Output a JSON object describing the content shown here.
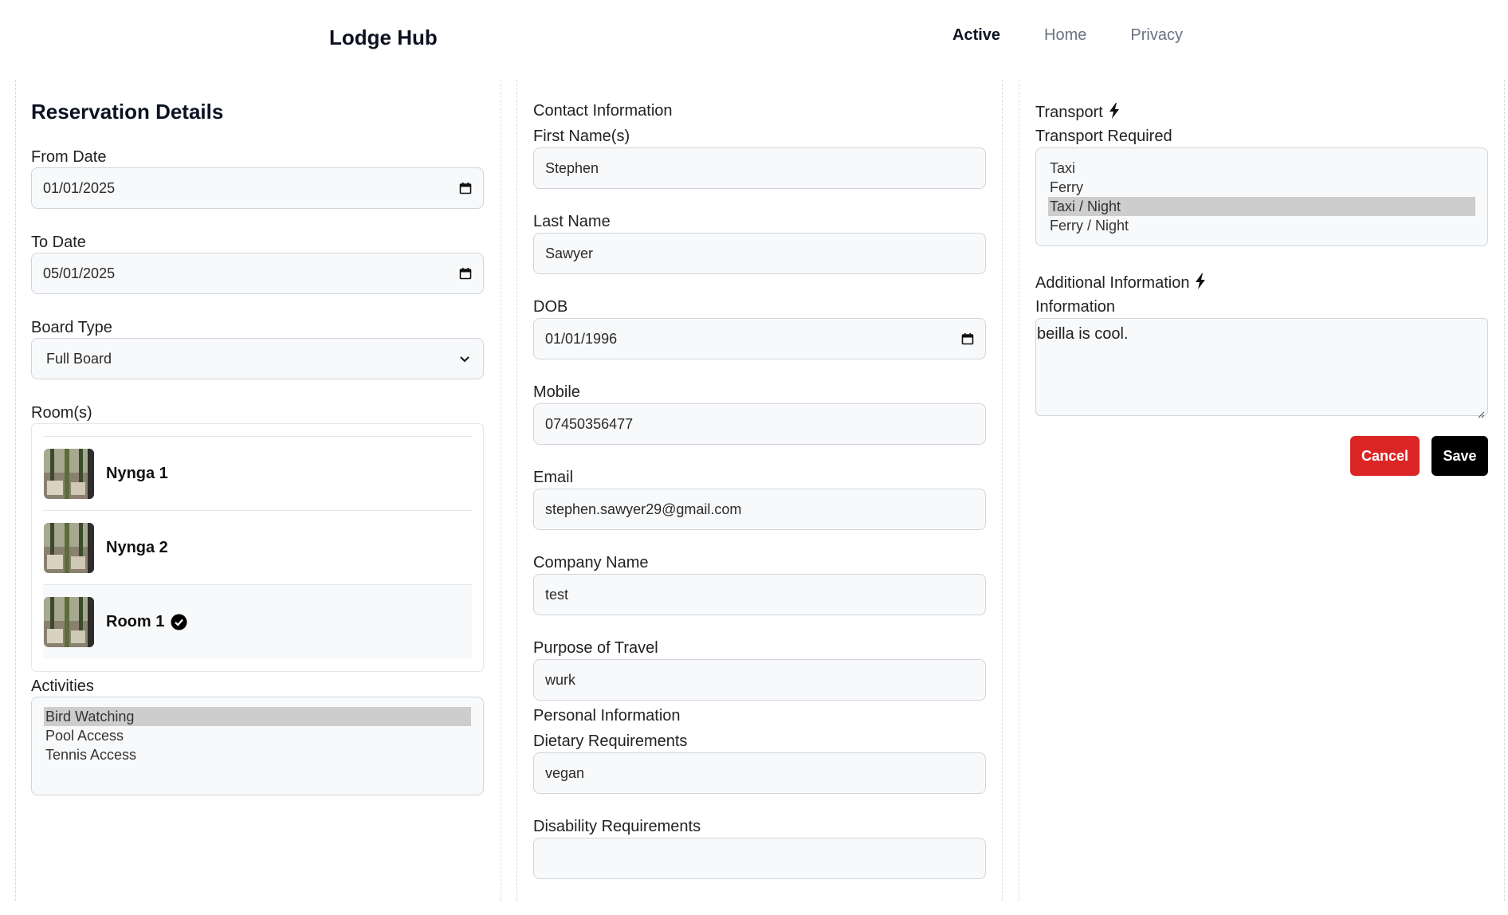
{
  "header": {
    "brand": "Lodge Hub",
    "nav": [
      {
        "label": "Active",
        "active": true
      },
      {
        "label": "Home",
        "active": false
      },
      {
        "label": "Privacy",
        "active": false
      }
    ]
  },
  "reservation": {
    "title": "Reservation Details",
    "from_date": {
      "label": "From Date",
      "value": "01/01/2025"
    },
    "to_date": {
      "label": "To Date",
      "value": "05/01/2025"
    },
    "board_type": {
      "label": "Board Type",
      "value": "Full Board"
    },
    "rooms": {
      "label": "Room(s)",
      "items": [
        {
          "name": "Nynga 1",
          "selected": false
        },
        {
          "name": "Nynga 2",
          "selected": false
        },
        {
          "name": "Room 1",
          "selected": true
        }
      ]
    },
    "activities": {
      "label": "Activities",
      "options": [
        "Bird Watching",
        "Pool Access",
        "Tennis Access"
      ],
      "selected": "Bird Watching"
    }
  },
  "contact": {
    "section_label": "Contact Information",
    "first_name": {
      "label": "First Name(s)",
      "value": "Stephen"
    },
    "last_name": {
      "label": "Last Name",
      "value": "Sawyer"
    },
    "dob": {
      "label": "DOB",
      "value": "01/01/1996"
    },
    "mobile": {
      "label": "Mobile",
      "value": "07450356477"
    },
    "email": {
      "label": "Email",
      "value": "stephen.sawyer29@gmail.com"
    },
    "company": {
      "label": "Company Name",
      "value": "test"
    },
    "purpose": {
      "label": "Purpose of Travel",
      "value": "wurk"
    },
    "personal_section_label": "Personal Information",
    "dietary": {
      "label": "Dietary Requirements",
      "value": "vegan"
    },
    "disability": {
      "label": "Disability Requirements",
      "value": ""
    }
  },
  "transport": {
    "section_label": "Transport",
    "label": "Transport Required",
    "options": [
      "Taxi",
      "Ferry",
      "Taxi / Night",
      "Ferry / Night"
    ],
    "selected": "Taxi / Night"
  },
  "additional": {
    "section_label": "Additional Information",
    "label": "Information",
    "value": "beilla is cool."
  },
  "actions": {
    "cancel_label": "Cancel",
    "save_label": "Save"
  },
  "colors": {
    "cancel": "#dc2626",
    "save": "#000000",
    "selected_option": "#cdcdcd"
  }
}
